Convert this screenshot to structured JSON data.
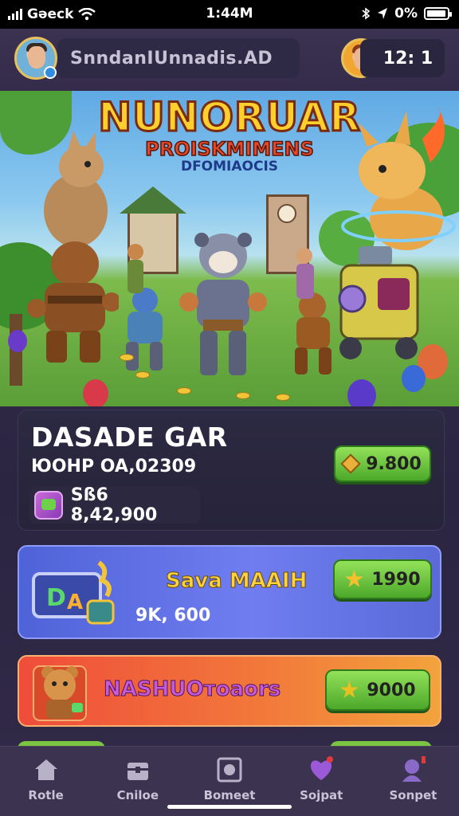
{
  "status_bar": {
    "carrier": "Gəeck",
    "time": "1:44M",
    "battery": "0%",
    "battery_level": 0.96
  },
  "header": {
    "username": "SnndanIUnnadis.AD",
    "currency": "12: 1"
  },
  "hero": {
    "title": "NUNORUAR",
    "subtitle": "PROISKMIMENS",
    "tagline": "DFOMIAOCIS"
  },
  "card_main": {
    "title": "DASADE GAR",
    "subtitle": "ЮOHP OA,02309",
    "balance": "Sß6 8,42,900",
    "price": "9.800"
  },
  "card_offer_1": {
    "title": "Sava MAAIH",
    "amount": "9K, 600",
    "price": "1990"
  },
  "card_offer_2": {
    "title": "NASHUOтoaors",
    "price": "9000"
  },
  "nav": {
    "items": [
      {
        "label": "Rotle",
        "icon": "home-icon"
      },
      {
        "label": "Cniloe",
        "icon": "chest-icon"
      },
      {
        "label": "Bomeet",
        "icon": "box-icon"
      },
      {
        "label": "Sojpat",
        "icon": "heart-icon"
      },
      {
        "label": "Sonpet",
        "icon": "profile-icon"
      }
    ]
  },
  "colors": {
    "accent_green": "#5cbf2e",
    "hero_title": "#ffcf2e",
    "background": "#2b2542"
  }
}
